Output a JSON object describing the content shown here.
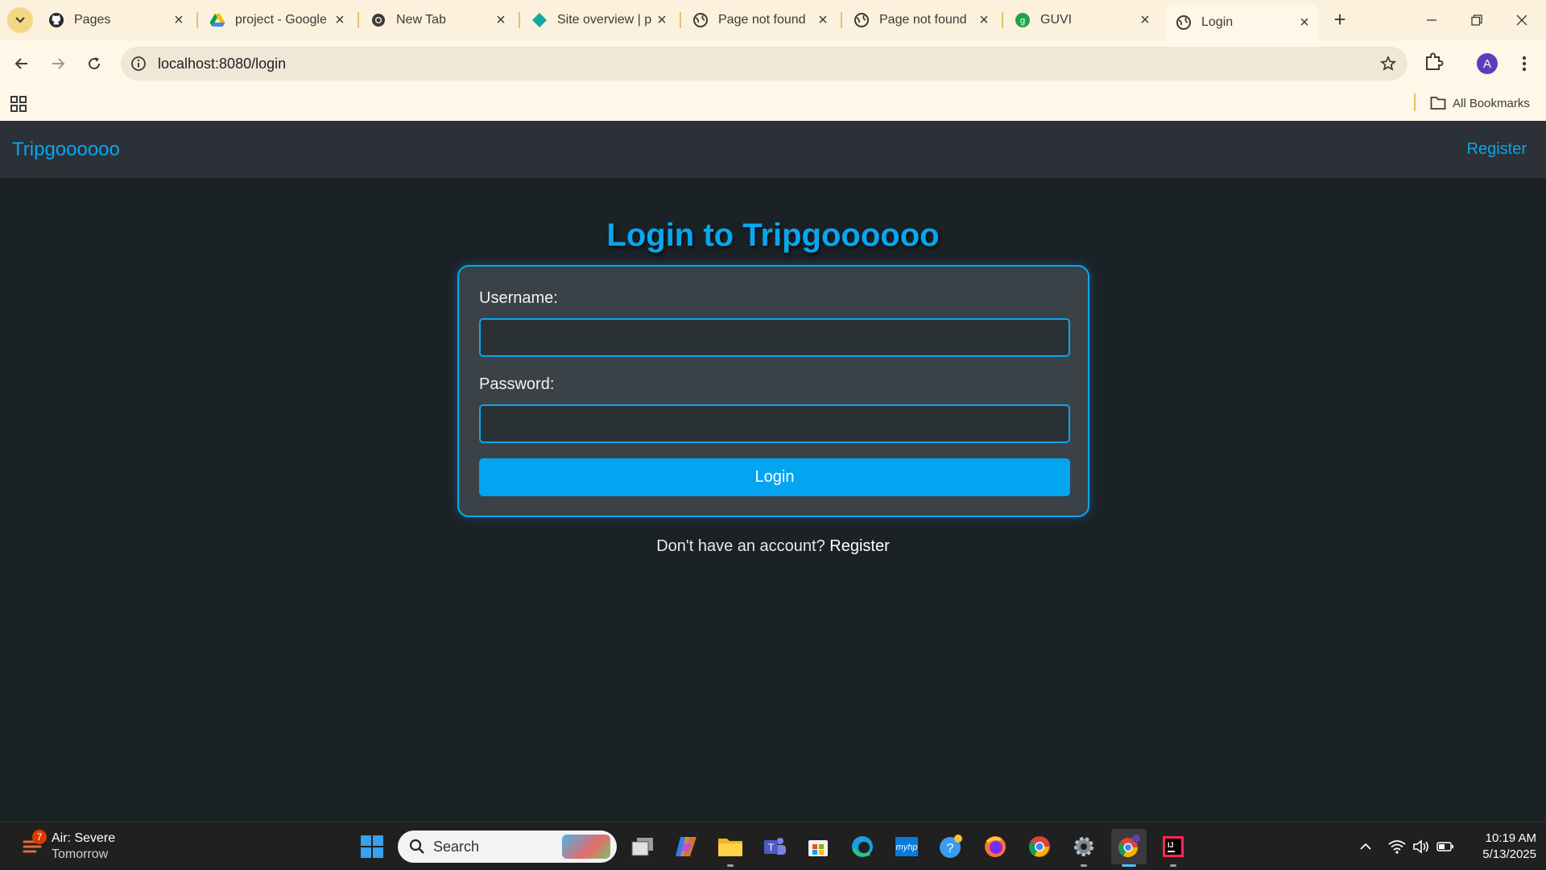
{
  "browser": {
    "tabs": [
      {
        "title": "Pages",
        "icon": "github-icon",
        "active": false
      },
      {
        "title": "project - Google",
        "icon": "google-drive-icon",
        "active": false
      },
      {
        "title": "New Tab",
        "icon": "globe-icon",
        "active": false
      },
      {
        "title": "Site overview | pi",
        "icon": "netlify-icon",
        "active": false
      },
      {
        "title": "Page not found",
        "icon": "globe-icon",
        "active": false
      },
      {
        "title": "Page not found",
        "icon": "globe-icon",
        "active": false
      },
      {
        "title": "GUVI",
        "icon": "guvi-icon",
        "active": false
      },
      {
        "title": "Login",
        "icon": "globe-icon",
        "active": true
      }
    ],
    "address_bar": {
      "url": "localhost:8080/login"
    },
    "profile_initial": "A",
    "bookmarks": {
      "all_bookmarks_label": "All Bookmarks"
    }
  },
  "site": {
    "brand": "Tripgoooooo",
    "nav_register": "Register",
    "login_title": "Login to Tripgoooooo",
    "form": {
      "username_label": "Username:",
      "username_value": "",
      "password_label": "Password:",
      "password_value": "",
      "submit_label": "Login"
    },
    "footer": {
      "prompt": "Don't have an account?",
      "register_link": "Register"
    },
    "colors": {
      "accent": "#0aa6ef",
      "background": "#1b2226",
      "card": "#3a4247"
    }
  },
  "taskbar": {
    "weather": {
      "badge": "7",
      "title": "Air: Severe",
      "subtitle": "Tomorrow"
    },
    "search_placeholder": "Search",
    "clock": {
      "time": "10:19 AM",
      "date": "5/13/2025"
    }
  }
}
